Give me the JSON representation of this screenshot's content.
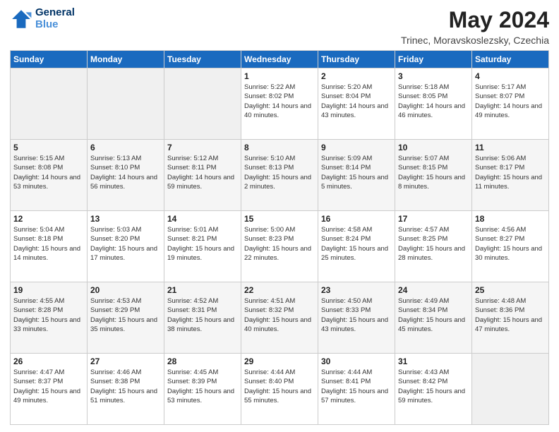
{
  "header": {
    "logo_line1": "General",
    "logo_line2": "Blue",
    "title": "May 2024",
    "subtitle": "Trinec, Moravskoslezsky, Czechia"
  },
  "days_of_week": [
    "Sunday",
    "Monday",
    "Tuesday",
    "Wednesday",
    "Thursday",
    "Friday",
    "Saturday"
  ],
  "weeks": [
    [
      {
        "day": "",
        "sunrise": "",
        "sunset": "",
        "daylight": ""
      },
      {
        "day": "",
        "sunrise": "",
        "sunset": "",
        "daylight": ""
      },
      {
        "day": "",
        "sunrise": "",
        "sunset": "",
        "daylight": ""
      },
      {
        "day": "1",
        "sunrise": "Sunrise: 5:22 AM",
        "sunset": "Sunset: 8:02 PM",
        "daylight": "Daylight: 14 hours and 40 minutes."
      },
      {
        "day": "2",
        "sunrise": "Sunrise: 5:20 AM",
        "sunset": "Sunset: 8:04 PM",
        "daylight": "Daylight: 14 hours and 43 minutes."
      },
      {
        "day": "3",
        "sunrise": "Sunrise: 5:18 AM",
        "sunset": "Sunset: 8:05 PM",
        "daylight": "Daylight: 14 hours and 46 minutes."
      },
      {
        "day": "4",
        "sunrise": "Sunrise: 5:17 AM",
        "sunset": "Sunset: 8:07 PM",
        "daylight": "Daylight: 14 hours and 49 minutes."
      }
    ],
    [
      {
        "day": "5",
        "sunrise": "Sunrise: 5:15 AM",
        "sunset": "Sunset: 8:08 PM",
        "daylight": "Daylight: 14 hours and 53 minutes."
      },
      {
        "day": "6",
        "sunrise": "Sunrise: 5:13 AM",
        "sunset": "Sunset: 8:10 PM",
        "daylight": "Daylight: 14 hours and 56 minutes."
      },
      {
        "day": "7",
        "sunrise": "Sunrise: 5:12 AM",
        "sunset": "Sunset: 8:11 PM",
        "daylight": "Daylight: 14 hours and 59 minutes."
      },
      {
        "day": "8",
        "sunrise": "Sunrise: 5:10 AM",
        "sunset": "Sunset: 8:13 PM",
        "daylight": "Daylight: 15 hours and 2 minutes."
      },
      {
        "day": "9",
        "sunrise": "Sunrise: 5:09 AM",
        "sunset": "Sunset: 8:14 PM",
        "daylight": "Daylight: 15 hours and 5 minutes."
      },
      {
        "day": "10",
        "sunrise": "Sunrise: 5:07 AM",
        "sunset": "Sunset: 8:15 PM",
        "daylight": "Daylight: 15 hours and 8 minutes."
      },
      {
        "day": "11",
        "sunrise": "Sunrise: 5:06 AM",
        "sunset": "Sunset: 8:17 PM",
        "daylight": "Daylight: 15 hours and 11 minutes."
      }
    ],
    [
      {
        "day": "12",
        "sunrise": "Sunrise: 5:04 AM",
        "sunset": "Sunset: 8:18 PM",
        "daylight": "Daylight: 15 hours and 14 minutes."
      },
      {
        "day": "13",
        "sunrise": "Sunrise: 5:03 AM",
        "sunset": "Sunset: 8:20 PM",
        "daylight": "Daylight: 15 hours and 17 minutes."
      },
      {
        "day": "14",
        "sunrise": "Sunrise: 5:01 AM",
        "sunset": "Sunset: 8:21 PM",
        "daylight": "Daylight: 15 hours and 19 minutes."
      },
      {
        "day": "15",
        "sunrise": "Sunrise: 5:00 AM",
        "sunset": "Sunset: 8:23 PM",
        "daylight": "Daylight: 15 hours and 22 minutes."
      },
      {
        "day": "16",
        "sunrise": "Sunrise: 4:58 AM",
        "sunset": "Sunset: 8:24 PM",
        "daylight": "Daylight: 15 hours and 25 minutes."
      },
      {
        "day": "17",
        "sunrise": "Sunrise: 4:57 AM",
        "sunset": "Sunset: 8:25 PM",
        "daylight": "Daylight: 15 hours and 28 minutes."
      },
      {
        "day": "18",
        "sunrise": "Sunrise: 4:56 AM",
        "sunset": "Sunset: 8:27 PM",
        "daylight": "Daylight: 15 hours and 30 minutes."
      }
    ],
    [
      {
        "day": "19",
        "sunrise": "Sunrise: 4:55 AM",
        "sunset": "Sunset: 8:28 PM",
        "daylight": "Daylight: 15 hours and 33 minutes."
      },
      {
        "day": "20",
        "sunrise": "Sunrise: 4:53 AM",
        "sunset": "Sunset: 8:29 PM",
        "daylight": "Daylight: 15 hours and 35 minutes."
      },
      {
        "day": "21",
        "sunrise": "Sunrise: 4:52 AM",
        "sunset": "Sunset: 8:31 PM",
        "daylight": "Daylight: 15 hours and 38 minutes."
      },
      {
        "day": "22",
        "sunrise": "Sunrise: 4:51 AM",
        "sunset": "Sunset: 8:32 PM",
        "daylight": "Daylight: 15 hours and 40 minutes."
      },
      {
        "day": "23",
        "sunrise": "Sunrise: 4:50 AM",
        "sunset": "Sunset: 8:33 PM",
        "daylight": "Daylight: 15 hours and 43 minutes."
      },
      {
        "day": "24",
        "sunrise": "Sunrise: 4:49 AM",
        "sunset": "Sunset: 8:34 PM",
        "daylight": "Daylight: 15 hours and 45 minutes."
      },
      {
        "day": "25",
        "sunrise": "Sunrise: 4:48 AM",
        "sunset": "Sunset: 8:36 PM",
        "daylight": "Daylight: 15 hours and 47 minutes."
      }
    ],
    [
      {
        "day": "26",
        "sunrise": "Sunrise: 4:47 AM",
        "sunset": "Sunset: 8:37 PM",
        "daylight": "Daylight: 15 hours and 49 minutes."
      },
      {
        "day": "27",
        "sunrise": "Sunrise: 4:46 AM",
        "sunset": "Sunset: 8:38 PM",
        "daylight": "Daylight: 15 hours and 51 minutes."
      },
      {
        "day": "28",
        "sunrise": "Sunrise: 4:45 AM",
        "sunset": "Sunset: 8:39 PM",
        "daylight": "Daylight: 15 hours and 53 minutes."
      },
      {
        "day": "29",
        "sunrise": "Sunrise: 4:44 AM",
        "sunset": "Sunset: 8:40 PM",
        "daylight": "Daylight: 15 hours and 55 minutes."
      },
      {
        "day": "30",
        "sunrise": "Sunrise: 4:44 AM",
        "sunset": "Sunset: 8:41 PM",
        "daylight": "Daylight: 15 hours and 57 minutes."
      },
      {
        "day": "31",
        "sunrise": "Sunrise: 4:43 AM",
        "sunset": "Sunset: 8:42 PM",
        "daylight": "Daylight: 15 hours and 59 minutes."
      },
      {
        "day": "",
        "sunrise": "",
        "sunset": "",
        "daylight": ""
      }
    ]
  ]
}
